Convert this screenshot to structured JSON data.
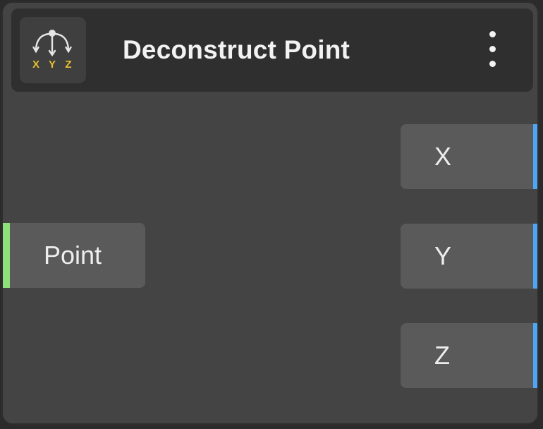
{
  "node": {
    "title": "Deconstruct Point",
    "icon": "deconstruct-point-icon",
    "icon_letters": [
      "X",
      "Y",
      "Z"
    ],
    "menu_icon": "more-vertical-icon"
  },
  "inputs": [
    {
      "label": "Point",
      "socket_color": "#8ee07a"
    }
  ],
  "outputs": [
    {
      "label": "X",
      "socket_color": "#4fa6f5"
    },
    {
      "label": "Y",
      "socket_color": "#4fa6f5"
    },
    {
      "label": "Z",
      "socket_color": "#4fa6f5"
    }
  ],
  "colors": {
    "node_background": "#444444",
    "header_background": "#2f2f2f",
    "port_background": "#5a5a5a",
    "icon_accent": "#e8c12f"
  }
}
